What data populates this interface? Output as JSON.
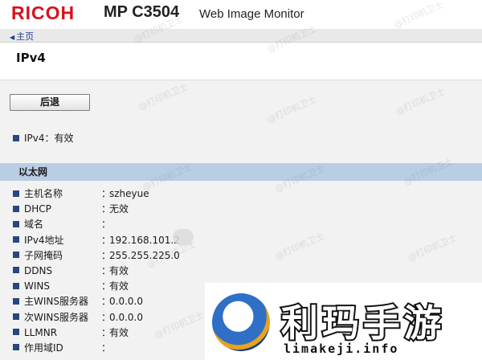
{
  "header": {
    "brand": "RICOH",
    "model": "MP C3504",
    "app_name": "Web Image Monitor"
  },
  "nav": {
    "home_label": "主页"
  },
  "page": {
    "title": "IPv4"
  },
  "actions": {
    "back_label": "后退"
  },
  "status": {
    "label": "IPv4",
    "separator": "：",
    "value": "有效"
  },
  "section": {
    "title": "以太网",
    "rows": [
      {
        "label": "主机名称",
        "value": "szheyue"
      },
      {
        "label": "DHCP",
        "value": "无效"
      },
      {
        "label": "域名",
        "value": ""
      },
      {
        "label": "IPv4地址",
        "value": "192.168.101.2"
      },
      {
        "label": "子网掩码",
        "value": "255.255.225.0"
      },
      {
        "label": "DDNS",
        "value": "有效"
      },
      {
        "label": "WINS",
        "value": "有效"
      },
      {
        "label": "主WINS服务器",
        "value": "0.0.0.0"
      },
      {
        "label": "次WINS服务器",
        "value": "0.0.0.0"
      },
      {
        "label": "LLMNR",
        "value": "有效"
      },
      {
        "label": "作用域ID",
        "value": ""
      }
    ],
    "separator": "："
  },
  "watermark": {
    "text": "@打印机卫士"
  },
  "ad": {
    "title": "利玛手游",
    "url": "limakeji.info"
  },
  "colors": {
    "brand_red": "#d8101c",
    "section_blue": "#b9cde3",
    "bullet_blue": "#29477f"
  }
}
